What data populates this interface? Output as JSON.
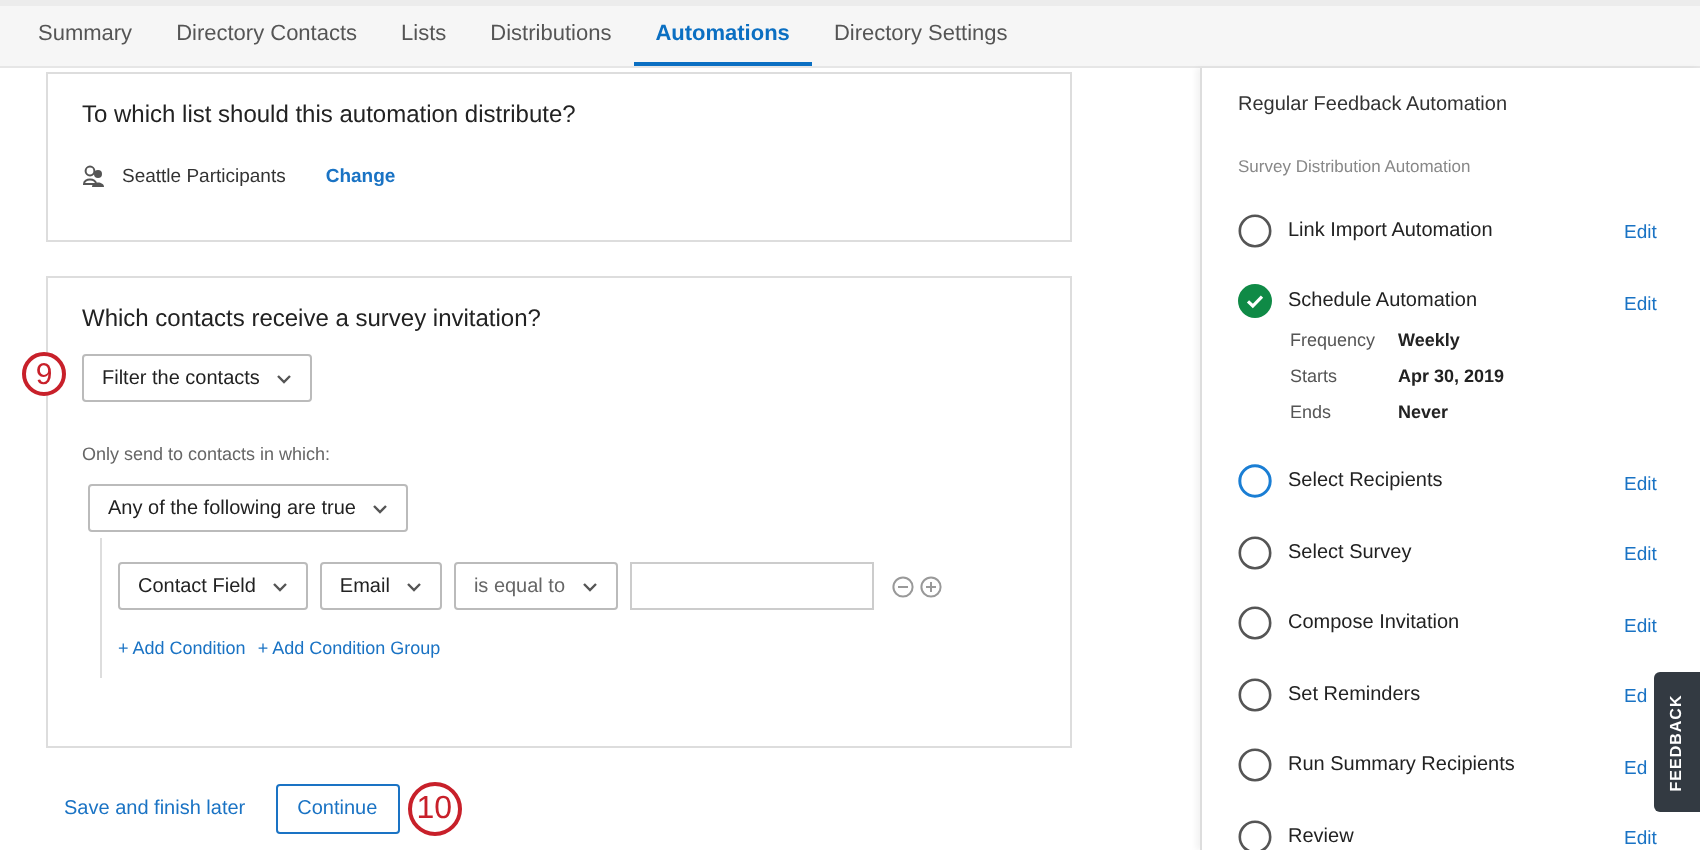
{
  "tabs": [
    {
      "label": "Summary",
      "selected": false
    },
    {
      "label": "Directory Contacts",
      "selected": false
    },
    {
      "label": "Lists",
      "selected": false
    },
    {
      "label": "Distributions",
      "selected": false
    },
    {
      "label": "Automations",
      "selected": true
    },
    {
      "label": "Directory Settings",
      "selected": false
    }
  ],
  "list_card": {
    "question": "To which list should this automation distribute?",
    "list_name": "Seattle Participants",
    "change_link": "Change"
  },
  "contacts_card": {
    "question": "Which contacts receive a survey invitation?",
    "callout": "9",
    "filter_dropdown": "Filter the contacts",
    "hint": "Only send to contacts in which:",
    "match_dropdown": "Any of the following are true",
    "condition": {
      "field_type": "Contact Field",
      "field": "Email",
      "operator": "is equal to"
    },
    "add_condition": "+ Add Condition",
    "add_group": "+ Add Condition Group"
  },
  "footer": {
    "save_link": "Save and finish later",
    "continue_button": "Continue",
    "callout": "10"
  },
  "sidebar": {
    "title": "Regular Feedback Automation",
    "subtitle": "Survey Distribution Automation",
    "steps": [
      {
        "label": "Link Import Automation",
        "kind": "todo",
        "edit": "Edit"
      },
      {
        "label": "Schedule Automation",
        "kind": "done",
        "edit": "Edit",
        "details": [
          {
            "key": "Frequency",
            "value": "Weekly"
          },
          {
            "key": "Starts",
            "value": "Apr 30, 2019"
          },
          {
            "key": "Ends",
            "value": "Never"
          }
        ]
      },
      {
        "label": "Select Recipients",
        "kind": "current",
        "edit": "Edit"
      },
      {
        "label": "Select Survey",
        "kind": "todo",
        "edit": "Edit"
      },
      {
        "label": "Compose Invitation",
        "kind": "todo",
        "edit": "Edit"
      },
      {
        "label": "Set Reminders",
        "kind": "todo",
        "edit": "Ed"
      },
      {
        "label": "Run Summary Recipients",
        "kind": "todo",
        "edit": "Ed"
      },
      {
        "label": "Review",
        "kind": "todo",
        "edit": "Edit"
      }
    ]
  },
  "feedback_tab": "FEEDBACK"
}
